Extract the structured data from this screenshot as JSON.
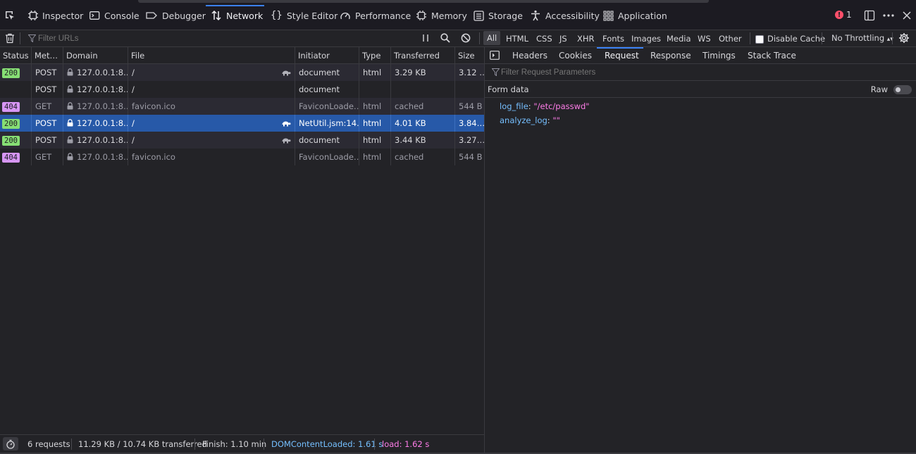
{
  "toolbar": {
    "tabs": [
      {
        "label": "Inspector",
        "icon": "inspector-icon"
      },
      {
        "label": "Console",
        "icon": "console-icon"
      },
      {
        "label": "Debugger",
        "icon": "debugger-icon"
      },
      {
        "label": "Network",
        "icon": "network-icon",
        "active": true
      },
      {
        "label": "Style Editor",
        "icon": "style-editor-icon"
      },
      {
        "label": "Performance",
        "icon": "performance-icon"
      },
      {
        "label": "Memory",
        "icon": "memory-icon"
      },
      {
        "label": "Storage",
        "icon": "storage-icon"
      },
      {
        "label": "Accessibility",
        "icon": "accessibility-icon"
      },
      {
        "label": "Application",
        "icon": "application-icon"
      }
    ],
    "error_count": "1"
  },
  "filterbar": {
    "filter_placeholder": "Filter URLs",
    "types": [
      "All",
      "HTML",
      "CSS",
      "JS",
      "XHR",
      "Fonts",
      "Images",
      "Media",
      "WS",
      "Other"
    ],
    "active_type": "All",
    "disable_cache_label": "Disable Cache",
    "throttling_label": "No Throttling"
  },
  "table": {
    "columns": [
      "Status",
      "Met…",
      "Domain",
      "File",
      "Initiator",
      "Type",
      "Transferred",
      "Size"
    ],
    "rows": [
      {
        "status": "200",
        "method": "POST",
        "domain": "127.0.0.1:8…",
        "file": "/",
        "initiator": "document",
        "type": "html",
        "transferred": "3.29 KB",
        "size": "3.12 …",
        "turtle": true
      },
      {
        "status": "",
        "method": "POST",
        "domain": "127.0.0.1:8…",
        "file": "/",
        "initiator": "document",
        "type": "",
        "transferred": "",
        "size": "",
        "turtle": false
      },
      {
        "status": "404",
        "method": "GET",
        "domain": "127.0.0.1:8…",
        "file": "favicon.ico",
        "initiator": "FaviconLoade…",
        "type": "html",
        "transferred": "cached",
        "size": "544 B",
        "turtle": false,
        "dim": true,
        "link": true
      },
      {
        "status": "200",
        "method": "POST",
        "domain": "127.0.0.1:8…",
        "file": "/",
        "initiator": "NetUtil.jsm:14…",
        "type": "html",
        "transferred": "4.01 KB",
        "size": "3.84…",
        "turtle": true,
        "selected": true
      },
      {
        "status": "200",
        "method": "POST",
        "domain": "127.0.0.1:8…",
        "file": "/",
        "initiator": "document",
        "type": "html",
        "transferred": "3.44 KB",
        "size": "3.27…",
        "turtle": true
      },
      {
        "status": "404",
        "method": "GET",
        "domain": "127.0.0.1:8…",
        "file": "favicon.ico",
        "initiator": "FaviconLoade…",
        "type": "html",
        "transferred": "cached",
        "size": "544 B",
        "turtle": false,
        "dim": true,
        "link": true
      }
    ]
  },
  "statusbar": {
    "requests": "6 requests",
    "transferred": "11.29 KB / 10.74 KB transferred",
    "finish": "Finish: 1.10 min",
    "dom_content_loaded": "DOMContentLoaded: 1.61 s",
    "load": "load: 1.62 s"
  },
  "details": {
    "tabs": [
      "Headers",
      "Cookies",
      "Request",
      "Response",
      "Timings",
      "Stack Trace"
    ],
    "active_tab": "Request",
    "filter_placeholder": "Filter Request Parameters",
    "section_title": "Form data",
    "raw_label": "Raw",
    "params": [
      {
        "key": "log_file",
        "value": "\"/etc/passwd\""
      },
      {
        "key": "analyze_log",
        "value": "\"\""
      }
    ]
  },
  "colors": {
    "accent": "#3b82f6",
    "status_ok": "#86de74",
    "status_not_found": "#d796f5",
    "selected_row": "#2759a8"
  }
}
